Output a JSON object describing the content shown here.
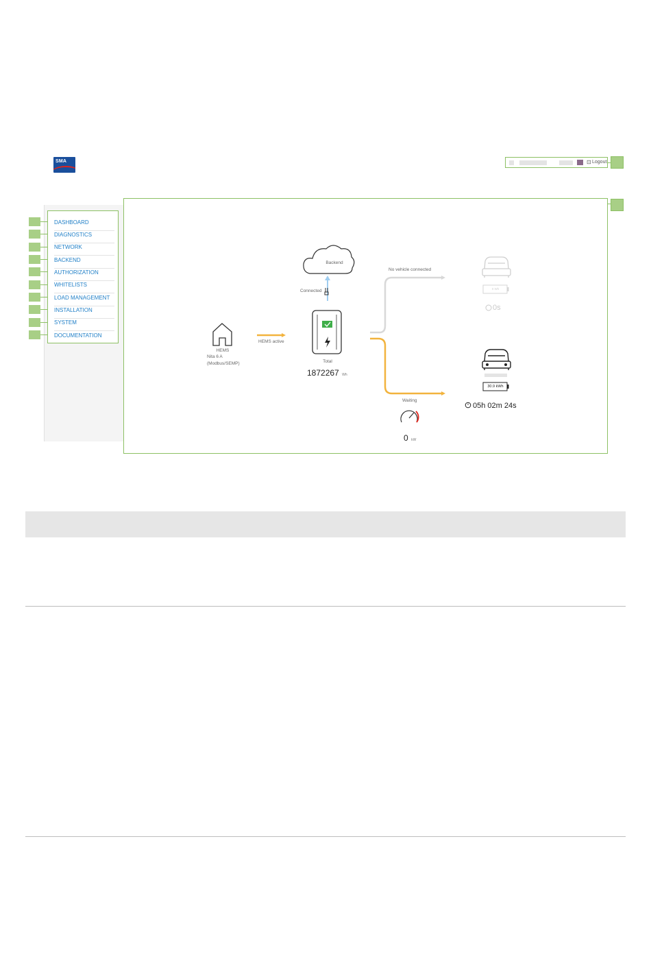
{
  "header": {
    "logo_text": "SMA",
    "logout_label": "Logout"
  },
  "sidebar": {
    "items": [
      {
        "label": "DASHBOARD"
      },
      {
        "label": "DIAGNOSTICS"
      },
      {
        "label": "NETWORK"
      },
      {
        "label": "BACKEND"
      },
      {
        "label": "AUTHORIZATION"
      },
      {
        "label": "WHITELISTS"
      },
      {
        "label": "LOAD MANAGEMENT"
      },
      {
        "label": "INSTALLATION"
      },
      {
        "label": "SYSTEM"
      },
      {
        "label": "DOCUMENTATION"
      }
    ]
  },
  "dashboard": {
    "backend": {
      "label": "Backend",
      "status": "Connected"
    },
    "hems": {
      "label": "HEMS",
      "line1": "Nita 6 A",
      "line2": "(Modbus/SEMP)",
      "flow_label": "HEMS active"
    },
    "charger": {
      "total_label": "Total",
      "total_value": "1872267",
      "total_unit": "Wh"
    },
    "vehicle_top": {
      "status": "No vehicle connected",
      "battery": "0 Wh",
      "time": "0s"
    },
    "vehicle_bottom": {
      "battery": "30.9 kWh",
      "time": "05h 02m 24s"
    },
    "meter": {
      "status": "Waiting",
      "value": "0",
      "unit": "kW"
    }
  },
  "colors": {
    "accent_green": "#8cc063",
    "flow_yellow": "#f2b33d",
    "link_blue": "#1f7fc7",
    "backend_blue": "#9fcdf0"
  }
}
